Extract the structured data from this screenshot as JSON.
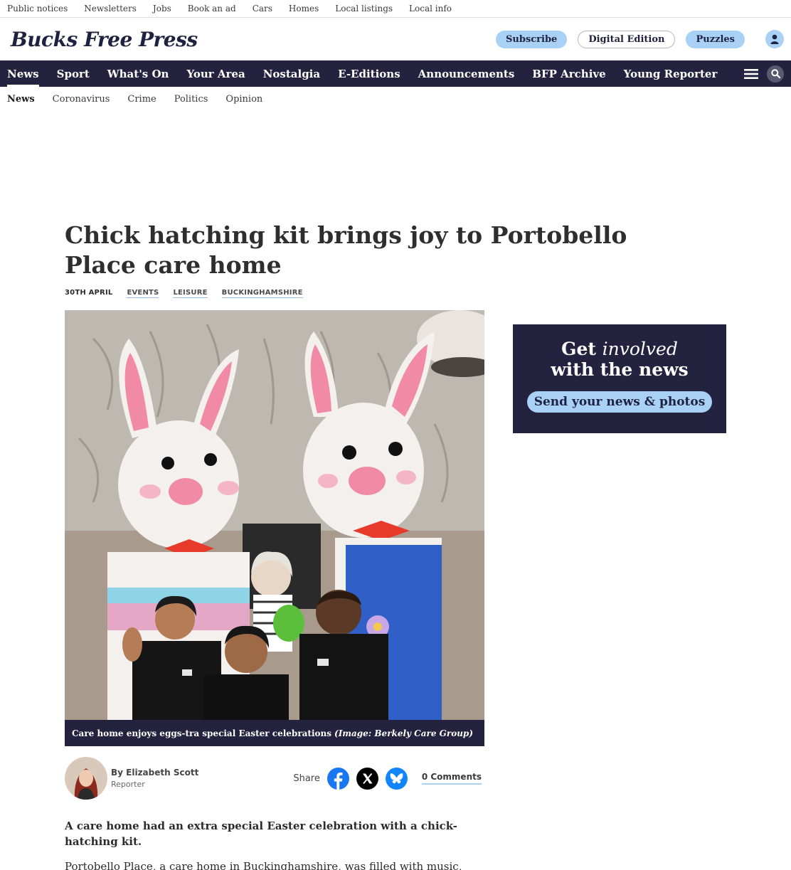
{
  "utility": {
    "links": [
      "Public notices",
      "Newsletters",
      "Jobs",
      "Book an ad",
      "Cars",
      "Homes",
      "Local listings",
      "Local info"
    ]
  },
  "masthead": {
    "logo": "Bucks Free Press",
    "subscribe": "Subscribe",
    "digital_edition": "Digital Edition",
    "puzzles": "Puzzles"
  },
  "nav": {
    "items": [
      "News",
      "Sport",
      "What's On",
      "Your Area",
      "Nostalgia",
      "E-Editions",
      "Announcements",
      "BFP Archive",
      "Young Reporter"
    ],
    "active": "News"
  },
  "subnav": {
    "items": [
      "News",
      "Coronavirus",
      "Crime",
      "Politics",
      "Opinion"
    ]
  },
  "article": {
    "headline": "Chick hatching kit brings joy to Portobello Place care home",
    "date": "30TH APRIL",
    "tags": [
      "EVENTS",
      "LEISURE",
      "BUCKINGHAMSHIRE"
    ],
    "caption": "Care home enjoys eggs-tra special Easter celebrations",
    "credit": "(Image: Berkely Care Group)",
    "author_name": "By Elizabeth Scott",
    "author_role": "Reporter",
    "share_label": "Share",
    "comments": "0 Comments",
    "standfirst": "A care home had an extra special Easter celebration with a chick-hatching kit.",
    "body_start": "Portobello Place, a care home in Buckinghamshire, was filled with music,"
  },
  "promo": {
    "get": "Get",
    "involved": "involved",
    "line2": "with the news",
    "button": "Send your news & photos"
  },
  "colors": {
    "navy": "#23233f",
    "accent_blue": "#a9d0f5",
    "facebook": "#1877f2",
    "bluesky": "#1185fe"
  }
}
